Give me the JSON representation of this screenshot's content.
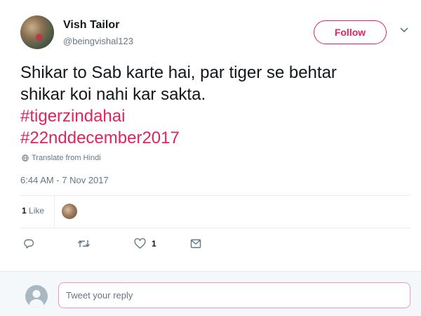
{
  "user": {
    "display_name": "Vish Tailor",
    "handle": "@beingvishal123"
  },
  "follow_button": {
    "label": "Follow"
  },
  "tweet": {
    "lines": [
      "Shikar to Sab karte hai, par tiger se behtar",
      "shikar koi nahi kar sakta."
    ],
    "hashtags": [
      "#tigerzindahai",
      "#22nddecember2017"
    ],
    "translate_label": "Translate from Hindi",
    "timestamp": "6:44 AM - 7 Nov 2017"
  },
  "stats": {
    "likes_count": "1",
    "likes_label": "Like"
  },
  "actions": {
    "like_count": "1"
  },
  "reply": {
    "placeholder": "Tweet your reply"
  },
  "colors": {
    "accent": "#e0245e",
    "muted": "#657786",
    "divider": "#e6ecf0"
  }
}
